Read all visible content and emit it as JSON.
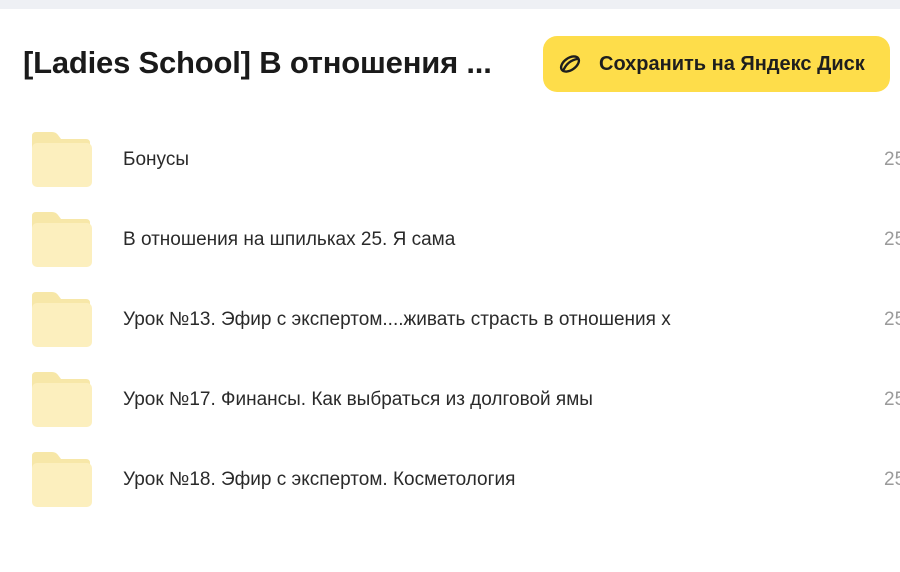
{
  "header": {
    "title": "[Ladies School] В отношения ...",
    "save_button": {
      "label": "Сохранить на Яндекс Диск",
      "icon": "yandex-disk-save-icon",
      "color": "#fedd4a"
    }
  },
  "items": [
    {
      "name": "Бонусы",
      "date": "25",
      "icon": "folder-icon"
    },
    {
      "name": "В отношения на шпильках 25. Я сама",
      "date": "25",
      "icon": "folder-icon"
    },
    {
      "name": "Урок №13. Эфир с экспертом....живать страсть в отношения х",
      "date": "25",
      "icon": "folder-icon"
    },
    {
      "name": "Урок №17. Финансы. Как выбраться из долговой ямы",
      "date": "25",
      "icon": "folder-icon"
    },
    {
      "name": "Урок №18. Эфир с экспертом. Косметология",
      "date": "25",
      "icon": "folder-icon"
    }
  ],
  "colors": {
    "folder_back": "#f7e7a8",
    "folder_front": "#fcefbe",
    "accent": "#fedd4a"
  }
}
